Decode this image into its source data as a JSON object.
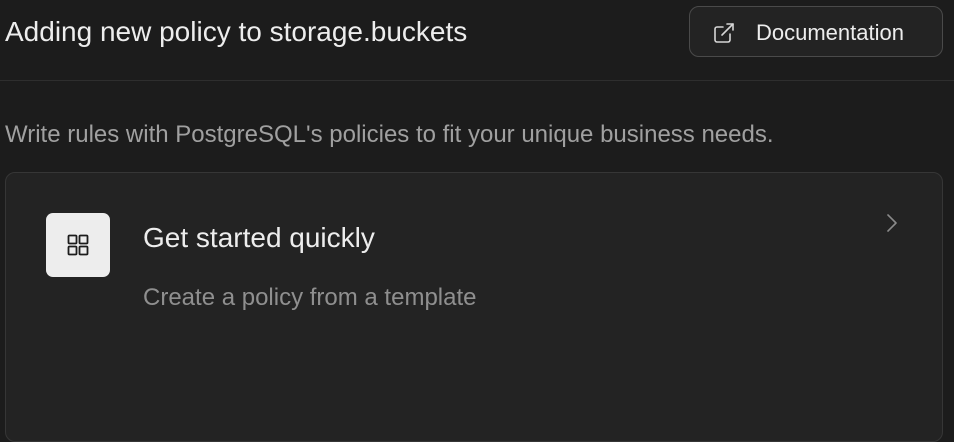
{
  "header": {
    "title": "Adding new policy to storage.buckets",
    "documentation_label": "Documentation",
    "documentation_icon": "external-link-icon"
  },
  "description": "Write rules with PostgreSQL's policies to fit your unique business needs.",
  "template_card": {
    "icon": "grid-icon",
    "title": "Get started quickly",
    "subtitle": "Create a policy from a template",
    "chevron_icon": "chevron-right-icon"
  },
  "colors": {
    "background": "#1c1c1c",
    "card_background": "#232323",
    "text_primary": "#ededed",
    "text_secondary": "#a0a0a0",
    "border": "#363636"
  }
}
